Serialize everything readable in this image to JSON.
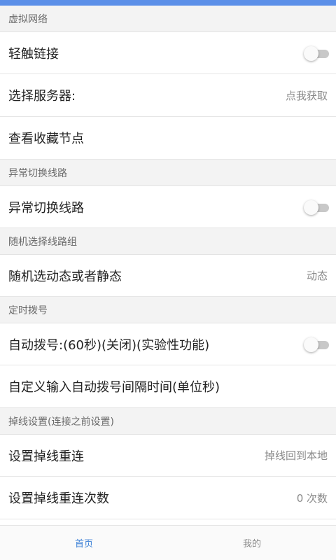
{
  "colors": {
    "accent": "#5b8fe8",
    "active_tab": "#3a7fd6",
    "toggle_off_track": "#c8c8c8",
    "section_bg": "#f3f3f3"
  },
  "sections": {
    "virtual_network": {
      "title": "虚拟网络",
      "light_touch_link": {
        "label": "轻触链接",
        "enabled": false
      },
      "select_server": {
        "label": "选择服务器:",
        "value": "点我获取"
      },
      "view_favorites": {
        "label": "查看收藏节点"
      }
    },
    "failover": {
      "title": "异常切换线路",
      "failover_switch": {
        "label": "异常切换线路",
        "enabled": false
      }
    },
    "random_group": {
      "title": "随机选择线路组",
      "mode": {
        "label": "随机选动态或者静态",
        "value": "动态"
      }
    },
    "timed_dial": {
      "title": "定时拨号",
      "auto_dial": {
        "label": "自动拨号:(60秒)(关闭)(实验性功能)",
        "enabled": false
      },
      "custom_interval": {
        "label": "自定义输入自动拨号间隔时间(单位秒)"
      }
    },
    "disconnect": {
      "title": "掉线设置(连接之前设置)",
      "reconnect": {
        "label": "设置掉线重连",
        "value": "掉线回到本地"
      },
      "reconnect_count": {
        "label": "设置掉线重连次数",
        "value": "0 次数"
      }
    }
  },
  "bottom_nav": {
    "home": {
      "label": "首页",
      "active": true
    },
    "mine": {
      "label": "我的",
      "active": false
    }
  }
}
